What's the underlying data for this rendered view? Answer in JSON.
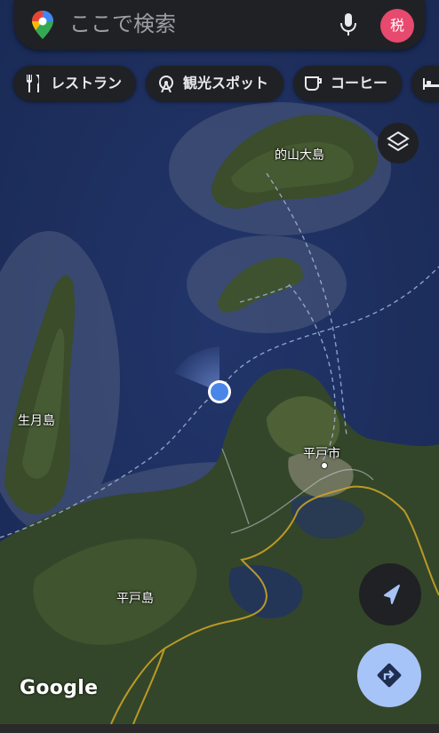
{
  "search": {
    "placeholder": "ここで検索",
    "avatar_text": "税"
  },
  "chips": [
    {
      "label": "レストラン",
      "icon": "fork-knife-icon"
    },
    {
      "label": "観光スポット",
      "icon": "ferris-wheel-icon"
    },
    {
      "label": "コーヒー",
      "icon": "coffee-cup-icon"
    },
    {
      "label": "",
      "icon": "bed-icon"
    }
  ],
  "map": {
    "labels": {
      "island_north": "的山大島",
      "island_west": "生月島",
      "city": "平戸市",
      "island_main": "平戸島"
    },
    "brand": "Google"
  },
  "colors": {
    "accent_blue": "#4a86e8",
    "road_yellow": "#c9a227",
    "directions_bg": "#a7c4f8",
    "avatar_bg": "#e8496e"
  }
}
